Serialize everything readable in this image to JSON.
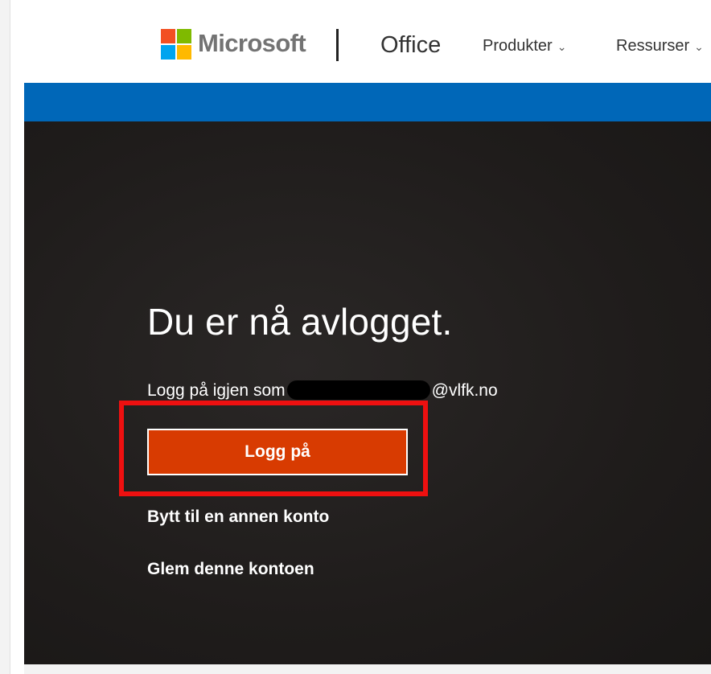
{
  "header": {
    "brand": "Microsoft",
    "product": "Office",
    "nav": [
      {
        "label": "Produkter",
        "icon": "chevron-down-icon"
      },
      {
        "label": "Ressurser",
        "icon": "chevron-down-icon"
      }
    ]
  },
  "main": {
    "heading": "Du er nå avlogget.",
    "relogin_prefix": "Logg på igjen som",
    "relogin_suffix": "@vlfk.no",
    "signin_button": "Logg på",
    "switch_account": "Bytt til en annen konto",
    "forget_account": "Glem denne kontoen"
  },
  "colors": {
    "accent_blue": "#0067b8",
    "signin_orange": "#d83b01",
    "highlight_red": "#ee1010",
    "hero_bg": "#1f1c1b"
  }
}
